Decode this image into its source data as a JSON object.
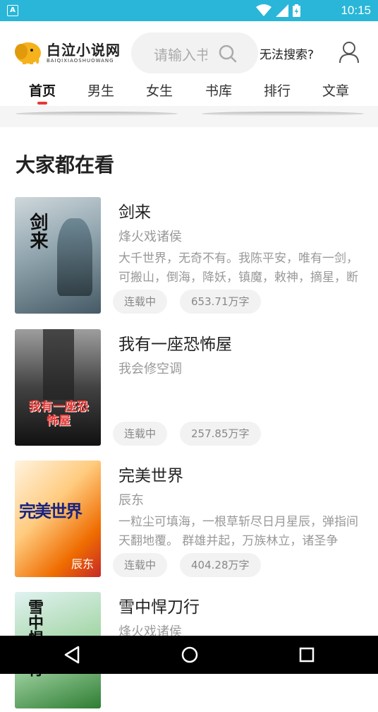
{
  "status_bar": {
    "time": "10:15",
    "app_badge": "A"
  },
  "header": {
    "logo_title": "白泣小说网",
    "logo_sub": "BAIQIXIAOSHUOWANG",
    "search_placeholder": "请输入书名或作者",
    "no_search_link": "无法搜索?"
  },
  "tabs": [
    {
      "label": "首页",
      "active": true
    },
    {
      "label": "男生"
    },
    {
      "label": "女生"
    },
    {
      "label": "书库"
    },
    {
      "label": "排行"
    },
    {
      "label": "文章"
    }
  ],
  "section_title": "大家都在看",
  "books": [
    {
      "title": "剑来",
      "author": "烽火戏诸侯",
      "description": "大千世界，无奇不有。我陈平安，唯有一剑，可搬山，倒海，降妖，镇魔，敕神，摘星，断江，摧城，开天！",
      "status": "连载中",
      "words": "653.71万字",
      "cover_text": "剑来"
    },
    {
      "title": "我有一座恐怖屋",
      "author": "我会修空调",
      "description": "",
      "status": "连载中",
      "words": "257.85万字",
      "cover_text": "我有一座恐怖屋"
    },
    {
      "title": "完美世界",
      "author": "辰东",
      "description": "一粒尘可填海，一根草斩尽日月星辰，弹指间天翻地覆。 群雄并起，万族林立，诸圣争霸，乱天动地。",
      "status": "连载中",
      "words": "404.28万字",
      "cover_text": "完美世界"
    },
    {
      "title": "雪中悍刀行",
      "author": "烽火戏诸侯",
      "description": "",
      "status": "",
      "words": "",
      "cover_text": "雪中悍刀行"
    }
  ],
  "colors": {
    "status_bar": "#29b6d8",
    "tab_indicator": "#e53935"
  },
  "icons": [
    "elephant-logo-icon",
    "search-icon",
    "user-icon",
    "wifi-icon",
    "signal-icon",
    "battery-icon",
    "back-icon",
    "home-icon",
    "recents-icon"
  ]
}
